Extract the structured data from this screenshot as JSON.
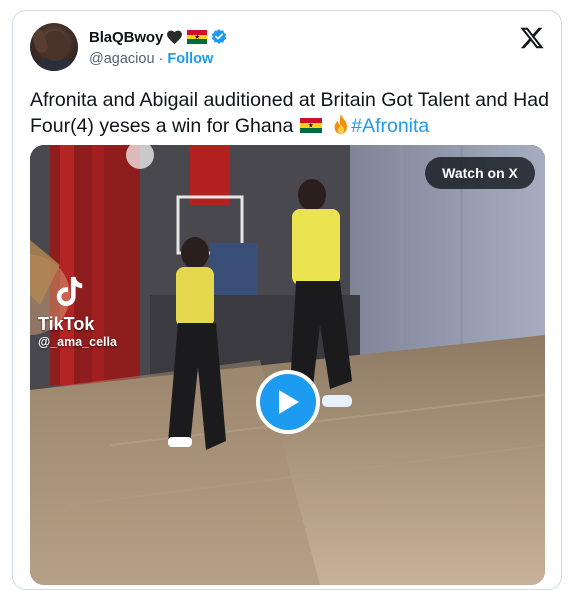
{
  "author": {
    "display_name": "BlaQBwoy",
    "handle": "@agaciou",
    "separator": "·",
    "follow_label": "Follow",
    "badge_icon": "verified-badge-icon",
    "emoji": [
      "black-heart-icon",
      "ghana-flag-icon"
    ]
  },
  "tweet": {
    "text_before": "Afronita and Abigail auditioned at Britain Got Talent and Had Four(4) yeses a win for Ghana ",
    "hashtag": "#Afronita",
    "emoji": [
      "ghana-flag-icon",
      "fire-icon"
    ]
  },
  "media": {
    "watch_label": "Watch on X",
    "watermark_brand": "TikTok",
    "watermark_user": "@_ama_cella"
  },
  "colors": {
    "accent": "#1d9bf0",
    "text_primary": "#0f1419",
    "text_secondary": "#536471",
    "border": "#cfd9de"
  }
}
